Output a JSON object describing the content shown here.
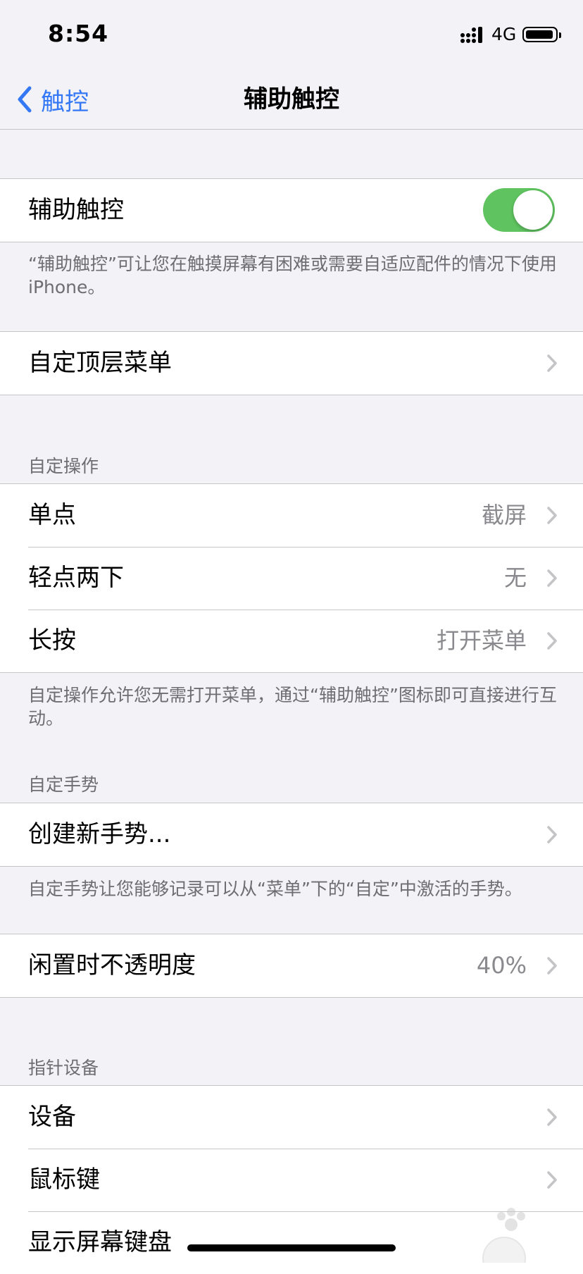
{
  "status_bar": {
    "time": "8:54",
    "network": "4G"
  },
  "nav": {
    "back_label": "触控",
    "title": "辅助触控"
  },
  "assistive_touch": {
    "label": "辅助触控",
    "enabled": true,
    "footer": "“辅助触控”可让您在触摸屏幕有困难或需要自适应配件的情况下使用iPhone。"
  },
  "top_menu": {
    "label": "自定顶层菜单"
  },
  "custom_actions": {
    "header": "自定操作",
    "items": [
      {
        "label": "单点",
        "value": "截屏"
      },
      {
        "label": "轻点两下",
        "value": "无"
      },
      {
        "label": "长按",
        "value": "打开菜单"
      }
    ],
    "footer": "自定操作允许您无需打开菜单，通过“辅助触控”图标即可直接进行互动。"
  },
  "custom_gestures": {
    "header": "自定手势",
    "create_label": "创建新手势...",
    "footer": "自定手势让您能够记录可以从“菜单”下的“自定”中激活的手势。"
  },
  "idle_opacity": {
    "label": "闲置时不透明度",
    "value": "40%"
  },
  "pointer_devices": {
    "header": "指针设备",
    "items": [
      {
        "label": "设备"
      },
      {
        "label": "鼠标键"
      },
      {
        "label": "显示屏幕键盘"
      }
    ]
  },
  "colors": {
    "accent": "#3478f6",
    "toggle_on": "#5fc35f",
    "background": "#f2f2f7"
  }
}
